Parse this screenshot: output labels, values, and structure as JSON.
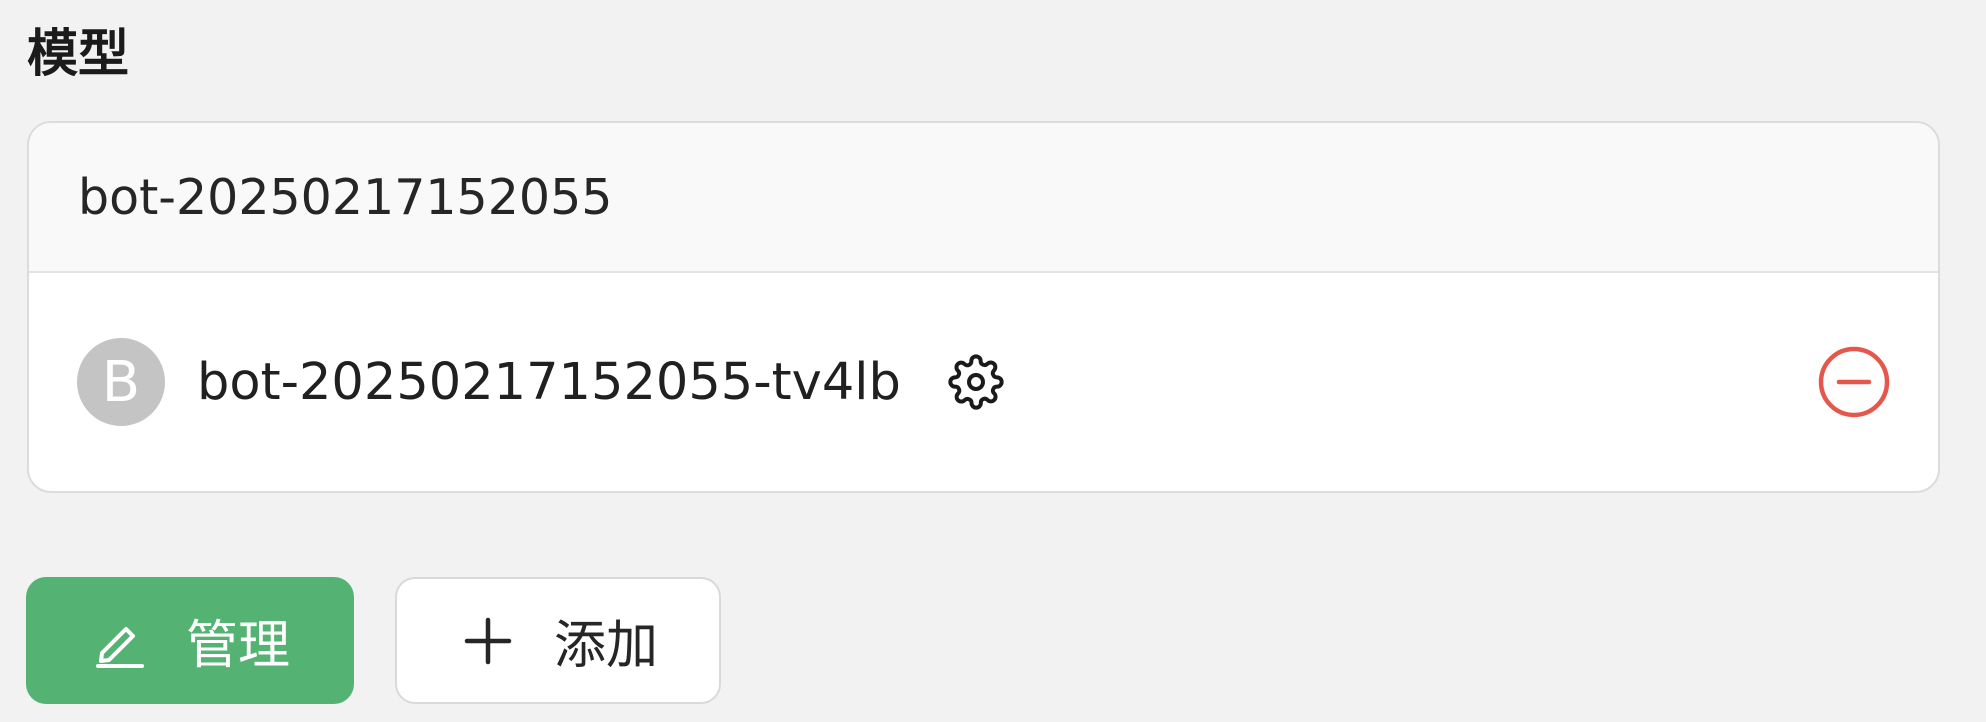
{
  "section": {
    "title": "模型"
  },
  "model_group": {
    "name": "bot-20250217152055",
    "models": [
      {
        "avatar_letter": "B",
        "name": "bot-20250217152055-tv4lb",
        "settings_icon": "gear-icon",
        "remove_icon": "minus-circle-icon"
      }
    ]
  },
  "actions": {
    "manage_label": "管理",
    "manage_icon": "edit-pen-icon",
    "add_label": "添加",
    "add_icon": "plus-icon"
  },
  "colors": {
    "primary_green": "#54b373",
    "danger_red": "#e5574b",
    "avatar_gray": "#c4c4c4"
  }
}
